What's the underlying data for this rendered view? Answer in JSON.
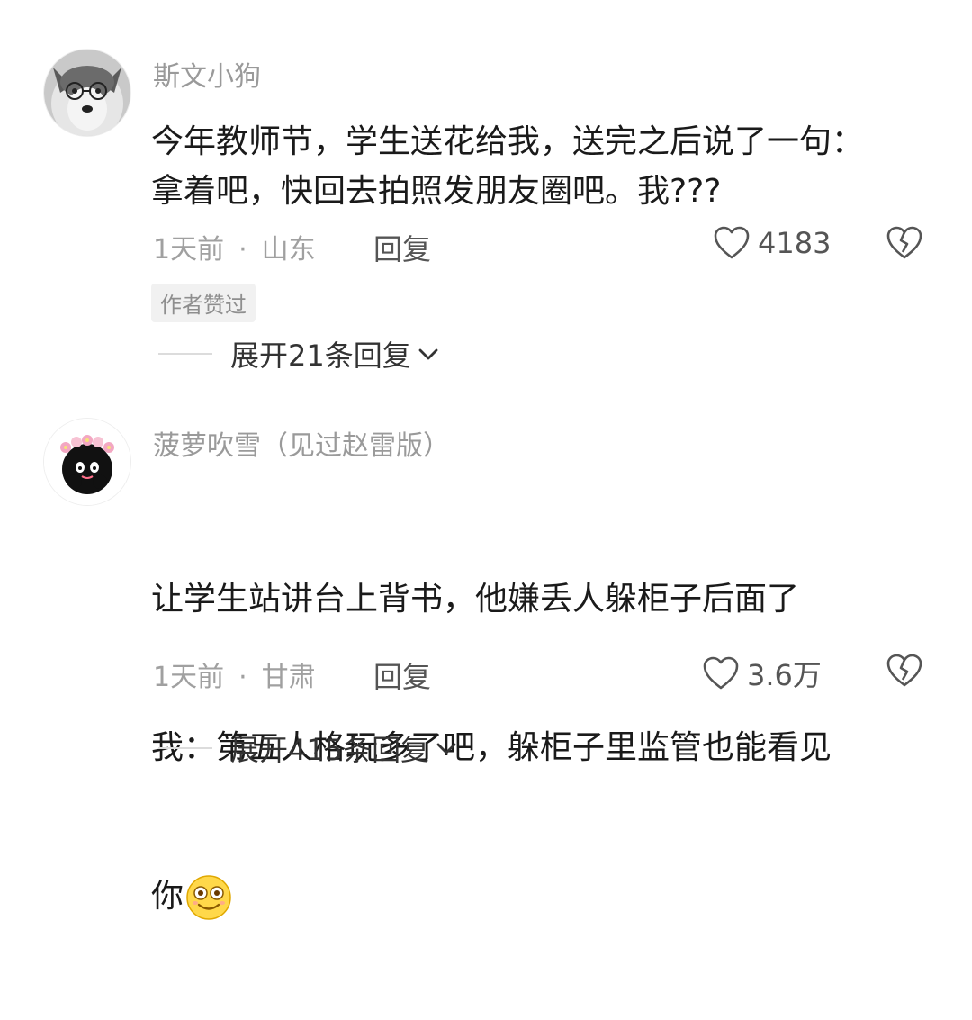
{
  "comments": [
    {
      "username": "斯文小狗",
      "text": "今年教师节，学生送花给我，送完之后说了一句：\n拿着吧，快回去拍照发朋友圈吧。我???",
      "time": "1天前",
      "separator": "·",
      "location": "山东",
      "reply_label": "回复",
      "likes": "4183",
      "badge": "作者赞过",
      "expand_label": "展开21条回复",
      "avatar_icon": "husky-dog-avatar"
    },
    {
      "username": "菠萝吹雪（见过赵雷版）",
      "text_lines": [
        "让学生站讲台上背书，他嫌丢人躲柜子后面了",
        "我：第五人格玩多了吧，躲柜子里监管也能看见",
        "你"
      ],
      "time": "1天前",
      "separator": "·",
      "location": "甘肃",
      "reply_label": "回复",
      "likes": "3.6万",
      "expand_label": "展开415条回复",
      "avatar_icon": "black-cat-with-flowers-avatar",
      "emoji_icon": "smiling-face-emoji"
    }
  ],
  "colors": {
    "username": "#9a9a9a",
    "meta": "#a0a0a0",
    "body_text": "#1a1a1a",
    "badge_bg": "#f1f1f1"
  }
}
